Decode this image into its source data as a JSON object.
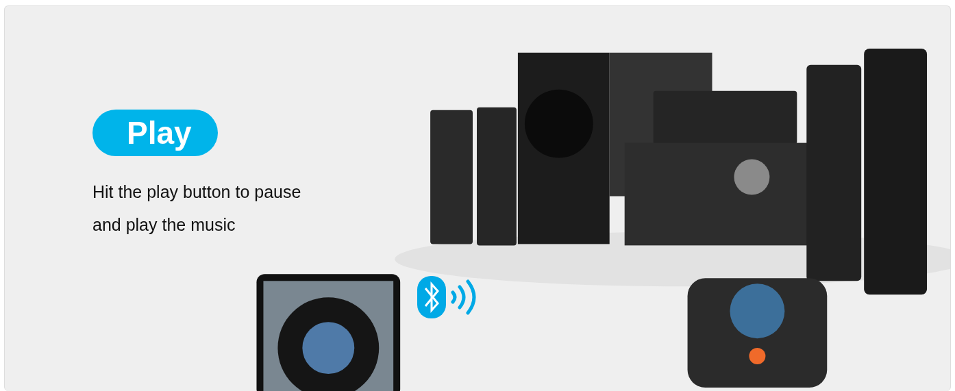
{
  "heading": {
    "text": "Play"
  },
  "description": "Hit the play button to pause and play the music"
}
